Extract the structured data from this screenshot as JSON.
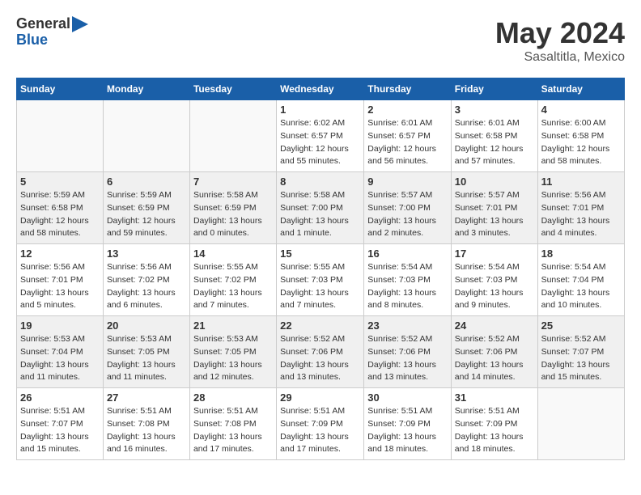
{
  "header": {
    "logo_general": "General",
    "logo_blue": "Blue",
    "month_title": "May 2024",
    "location": "Sasaltitla, Mexico"
  },
  "days_of_week": [
    "Sunday",
    "Monday",
    "Tuesday",
    "Wednesday",
    "Thursday",
    "Friday",
    "Saturday"
  ],
  "weeks": [
    [
      {
        "day": "",
        "info": ""
      },
      {
        "day": "",
        "info": ""
      },
      {
        "day": "",
        "info": ""
      },
      {
        "day": "1",
        "info": "Sunrise: 6:02 AM\nSunset: 6:57 PM\nDaylight: 12 hours\nand 55 minutes."
      },
      {
        "day": "2",
        "info": "Sunrise: 6:01 AM\nSunset: 6:57 PM\nDaylight: 12 hours\nand 56 minutes."
      },
      {
        "day": "3",
        "info": "Sunrise: 6:01 AM\nSunset: 6:58 PM\nDaylight: 12 hours\nand 57 minutes."
      },
      {
        "day": "4",
        "info": "Sunrise: 6:00 AM\nSunset: 6:58 PM\nDaylight: 12 hours\nand 58 minutes."
      }
    ],
    [
      {
        "day": "5",
        "info": "Sunrise: 5:59 AM\nSunset: 6:58 PM\nDaylight: 12 hours\nand 58 minutes."
      },
      {
        "day": "6",
        "info": "Sunrise: 5:59 AM\nSunset: 6:59 PM\nDaylight: 12 hours\nand 59 minutes."
      },
      {
        "day": "7",
        "info": "Sunrise: 5:58 AM\nSunset: 6:59 PM\nDaylight: 13 hours\nand 0 minutes."
      },
      {
        "day": "8",
        "info": "Sunrise: 5:58 AM\nSunset: 7:00 PM\nDaylight: 13 hours\nand 1 minute."
      },
      {
        "day": "9",
        "info": "Sunrise: 5:57 AM\nSunset: 7:00 PM\nDaylight: 13 hours\nand 2 minutes."
      },
      {
        "day": "10",
        "info": "Sunrise: 5:57 AM\nSunset: 7:01 PM\nDaylight: 13 hours\nand 3 minutes."
      },
      {
        "day": "11",
        "info": "Sunrise: 5:56 AM\nSunset: 7:01 PM\nDaylight: 13 hours\nand 4 minutes."
      }
    ],
    [
      {
        "day": "12",
        "info": "Sunrise: 5:56 AM\nSunset: 7:01 PM\nDaylight: 13 hours\nand 5 minutes."
      },
      {
        "day": "13",
        "info": "Sunrise: 5:56 AM\nSunset: 7:02 PM\nDaylight: 13 hours\nand 6 minutes."
      },
      {
        "day": "14",
        "info": "Sunrise: 5:55 AM\nSunset: 7:02 PM\nDaylight: 13 hours\nand 7 minutes."
      },
      {
        "day": "15",
        "info": "Sunrise: 5:55 AM\nSunset: 7:03 PM\nDaylight: 13 hours\nand 7 minutes."
      },
      {
        "day": "16",
        "info": "Sunrise: 5:54 AM\nSunset: 7:03 PM\nDaylight: 13 hours\nand 8 minutes."
      },
      {
        "day": "17",
        "info": "Sunrise: 5:54 AM\nSunset: 7:03 PM\nDaylight: 13 hours\nand 9 minutes."
      },
      {
        "day": "18",
        "info": "Sunrise: 5:54 AM\nSunset: 7:04 PM\nDaylight: 13 hours\nand 10 minutes."
      }
    ],
    [
      {
        "day": "19",
        "info": "Sunrise: 5:53 AM\nSunset: 7:04 PM\nDaylight: 13 hours\nand 11 minutes."
      },
      {
        "day": "20",
        "info": "Sunrise: 5:53 AM\nSunset: 7:05 PM\nDaylight: 13 hours\nand 11 minutes."
      },
      {
        "day": "21",
        "info": "Sunrise: 5:53 AM\nSunset: 7:05 PM\nDaylight: 13 hours\nand 12 minutes."
      },
      {
        "day": "22",
        "info": "Sunrise: 5:52 AM\nSunset: 7:06 PM\nDaylight: 13 hours\nand 13 minutes."
      },
      {
        "day": "23",
        "info": "Sunrise: 5:52 AM\nSunset: 7:06 PM\nDaylight: 13 hours\nand 13 minutes."
      },
      {
        "day": "24",
        "info": "Sunrise: 5:52 AM\nSunset: 7:06 PM\nDaylight: 13 hours\nand 14 minutes."
      },
      {
        "day": "25",
        "info": "Sunrise: 5:52 AM\nSunset: 7:07 PM\nDaylight: 13 hours\nand 15 minutes."
      }
    ],
    [
      {
        "day": "26",
        "info": "Sunrise: 5:51 AM\nSunset: 7:07 PM\nDaylight: 13 hours\nand 15 minutes."
      },
      {
        "day": "27",
        "info": "Sunrise: 5:51 AM\nSunset: 7:08 PM\nDaylight: 13 hours\nand 16 minutes."
      },
      {
        "day": "28",
        "info": "Sunrise: 5:51 AM\nSunset: 7:08 PM\nDaylight: 13 hours\nand 17 minutes."
      },
      {
        "day": "29",
        "info": "Sunrise: 5:51 AM\nSunset: 7:09 PM\nDaylight: 13 hours\nand 17 minutes."
      },
      {
        "day": "30",
        "info": "Sunrise: 5:51 AM\nSunset: 7:09 PM\nDaylight: 13 hours\nand 18 minutes."
      },
      {
        "day": "31",
        "info": "Sunrise: 5:51 AM\nSunset: 7:09 PM\nDaylight: 13 hours\nand 18 minutes."
      },
      {
        "day": "",
        "info": ""
      }
    ]
  ]
}
